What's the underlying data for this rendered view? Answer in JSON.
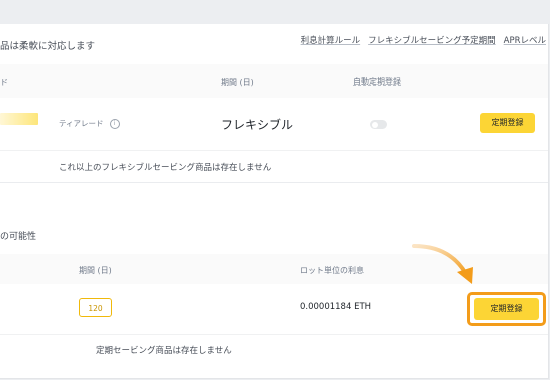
{
  "flexible": {
    "note": "品は柔軟に対応します",
    "links": [
      "利息計算ルール",
      "フレキシブルセービング予定期間",
      "APRレベル"
    ],
    "headers": {
      "col1": "ド",
      "period": "期間 (日)",
      "auto_renew": "自動定期登録"
    },
    "row": {
      "tier": "ティアレード",
      "period": "フレキシブル",
      "button": "定期登録"
    },
    "empty": "これ以上のフレキシブルセービング商品は存在しません"
  },
  "locked": {
    "heading": "の可能性",
    "headers": {
      "period": "期間 (日)",
      "interest": "ロット単位の利息"
    },
    "row": {
      "period": "120",
      "interest": "0.00001184 ETH",
      "button": "定期登録"
    },
    "empty": "定期セービング商品は存在しません"
  },
  "colors": {
    "accent": "#fcd535",
    "highlight": "#f39c1a"
  },
  "icons": {
    "info": "info-icon",
    "toggle": "toggle-switch",
    "arrow": "curved-arrow-annotation"
  }
}
